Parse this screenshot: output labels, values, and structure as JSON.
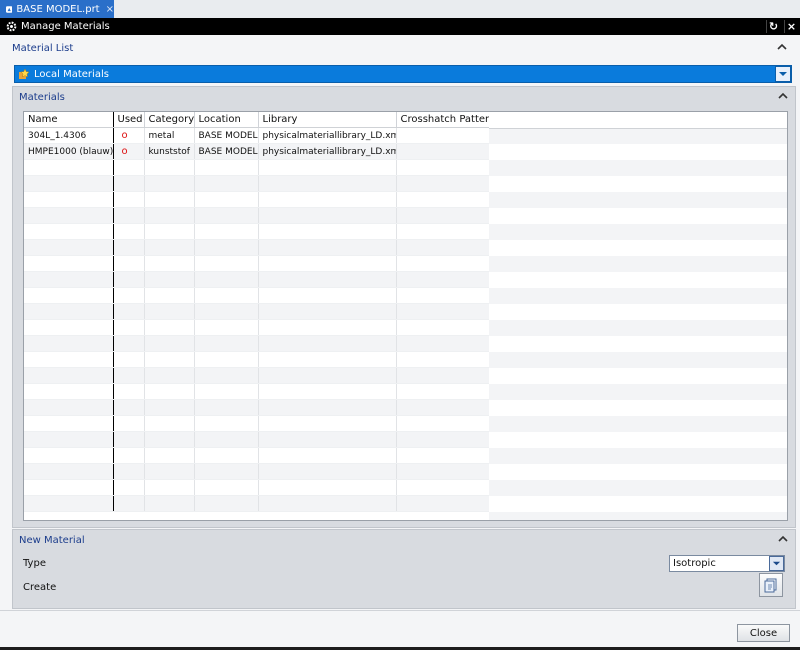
{
  "document_tab": {
    "title": "BASE MODEL.prt",
    "close_glyph": "×",
    "icon": "nx-app-icon",
    "accent": "#2a6fc9"
  },
  "window": {
    "title": "Manage Materials",
    "reset_glyph": "↻",
    "close_glyph": "×"
  },
  "material_list": {
    "heading": "Material List",
    "selected": "Local Materials"
  },
  "materials": {
    "heading": "Materials",
    "columns": [
      "Name",
      "Used",
      "Category",
      "Location",
      "Library",
      "Crosshatch Pattern"
    ],
    "rows": [
      {
        "name": "304L_1.4306",
        "used": "o",
        "category": "metal",
        "location": "BASE MODEL",
        "library": "physicalmateriallibrary_LD.xml",
        "crosshatch": ""
      },
      {
        "name": "HMPE1000 (blauw)",
        "used": "o",
        "category": "kunststof",
        "location": "BASE MODEL",
        "library": "physicalmateriallibrary_LD.xml",
        "crosshatch": ""
      }
    ]
  },
  "new_material": {
    "heading": "New Material",
    "type_label": "Type",
    "type_value": "Isotropic",
    "create_label": "Create"
  },
  "footer": {
    "close_label": "Close"
  },
  "colors": {
    "selection": "#0a7bdc",
    "heading_text": "#1c3d8c",
    "used_mark": "#dd1111"
  }
}
